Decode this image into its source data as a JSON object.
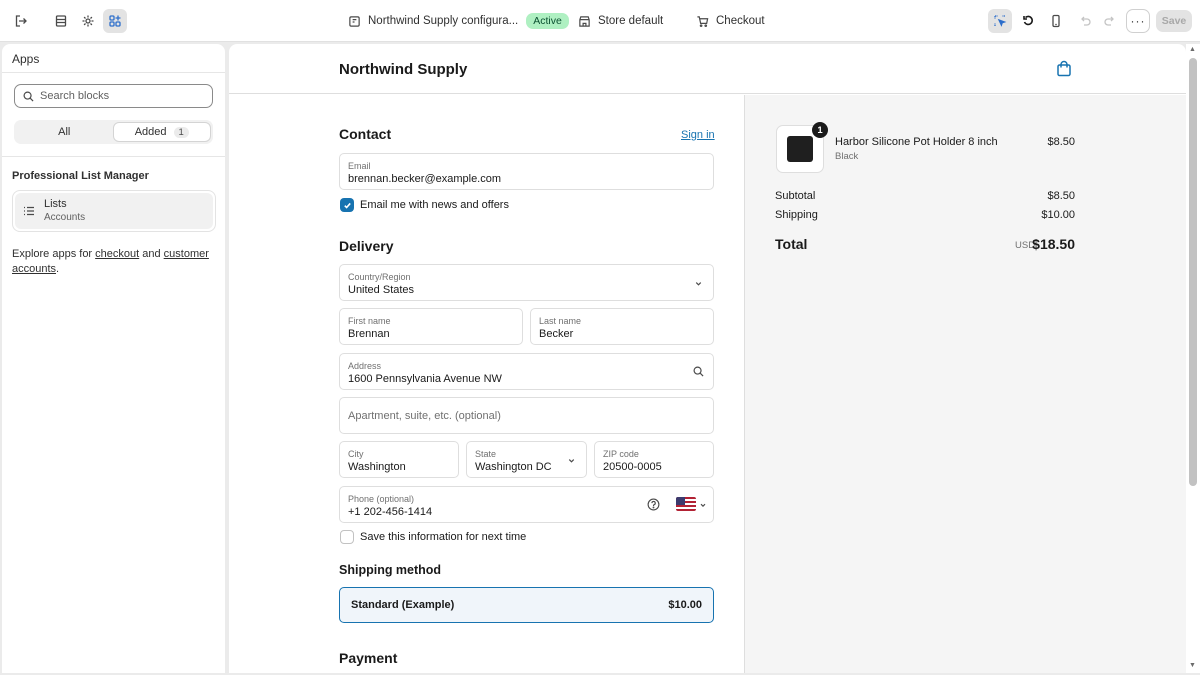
{
  "topbar": {
    "config_name": "Northwind Supply configura...",
    "status_badge": "Active",
    "store_label": "Store default",
    "page_label": "Checkout",
    "more_label": "···",
    "save_label": "Save"
  },
  "sidebar": {
    "title": "Apps",
    "search_placeholder": "Search blocks",
    "tabs": [
      {
        "label": "All",
        "selected": false
      },
      {
        "label": "Added",
        "count": "1",
        "selected": true
      }
    ],
    "section_title": "Professional List Manager",
    "app_block": {
      "name": "Lists",
      "subtitle": "Accounts",
      "icon": "list-icon"
    },
    "explore": {
      "prefix": "Explore apps for ",
      "link1": "checkout",
      "middle": " and ",
      "link2": "customer accounts",
      "suffix": "."
    }
  },
  "checkout": {
    "store_name": "Northwind Supply",
    "contact": {
      "heading": "Contact",
      "sign_in": "Sign in",
      "email_label": "Email",
      "email_value": "brennan.becker@example.com",
      "newsletter_label": "Email me with news and offers",
      "newsletter_checked": true
    },
    "delivery": {
      "heading": "Delivery",
      "country_label": "Country/Region",
      "country_value": "United States",
      "first_name_label": "First name",
      "first_name_value": "Brennan",
      "last_name_label": "Last name",
      "last_name_value": "Becker",
      "address_label": "Address",
      "address_value": "1600 Pennsylvania Avenue NW",
      "apartment_placeholder": "Apartment, suite, etc. (optional)",
      "city_label": "City",
      "city_value": "Washington",
      "state_label": "State",
      "state_value": "Washington DC",
      "zip_label": "ZIP code",
      "zip_value": "20500-0005",
      "phone_label": "Phone (optional)",
      "phone_value": "+1 202-456-1414",
      "save_info_label": "Save this information for next time",
      "save_info_checked": false
    },
    "shipping_method": {
      "heading": "Shipping method",
      "option_name": "Standard (Example)",
      "option_price": "$10.00"
    },
    "payment": {
      "heading": "Payment"
    }
  },
  "summary": {
    "item": {
      "name": "Harbor Silicone Pot Holder 8 inch",
      "variant": "Black",
      "quantity": "1",
      "price": "$8.50"
    },
    "subtotal_label": "Subtotal",
    "subtotal_value": "$8.50",
    "shipping_label": "Shipping",
    "shipping_value": "$10.00",
    "total_label": "Total",
    "total_currency": "USD",
    "total_value": "$18.50"
  },
  "colors": {
    "accent": "#1773b0",
    "badge_bg": "#aff0c2",
    "summary_bg": "#f5f5f5"
  }
}
